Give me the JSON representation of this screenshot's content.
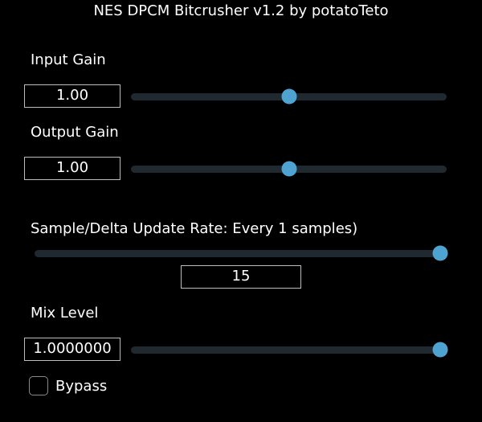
{
  "title": "NES DPCM Bitcrusher v1.2 by potatoTeto",
  "input_gain": {
    "label": "Input Gain",
    "value": "1.00",
    "level": 0.5
  },
  "output_gain": {
    "label": "Output Gain",
    "value": "1.00",
    "level": 0.5
  },
  "update_rate": {
    "label": "Sample/Delta Update Rate: Every 1 samples)",
    "value": "15",
    "level": 1.0
  },
  "mix_level": {
    "label": "Mix Level",
    "value": "1.0000000",
    "level": 1.0
  },
  "bypass": {
    "label": "Bypass",
    "checked": false
  },
  "colors": {
    "accent": "#4ea3d1",
    "track": "#1f292f",
    "background": "#000000",
    "border": "#bdbdbd"
  }
}
